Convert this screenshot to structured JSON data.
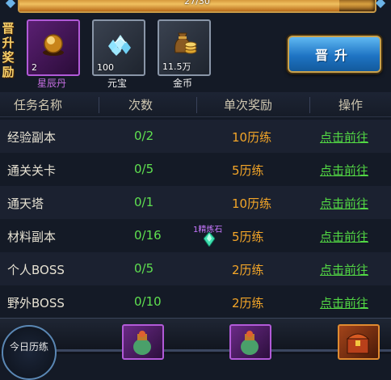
{
  "progress": {
    "text": "27/30",
    "fraction": 0.9
  },
  "section_title": "晋升奖励",
  "rewards": [
    {
      "name": "星辰丹",
      "count": "2",
      "icon": "golden-orb-icon",
      "rarity": "purple"
    },
    {
      "name": "元宝",
      "count": "100",
      "icon": "diamond-pile-icon",
      "rarity": "gray"
    },
    {
      "name": "金币",
      "count": "11.5万",
      "icon": "coin-bag-icon",
      "rarity": "gray"
    }
  ],
  "promote_button": "晋升",
  "table": {
    "headers": [
      "任务名称",
      "次数",
      "单次奖励",
      "操作"
    ],
    "rows": [
      {
        "name": "经验副本",
        "count": "0/2",
        "reward": "10历练",
        "action": "点击前往"
      },
      {
        "name": "通关关卡",
        "count": "0/5",
        "reward": "5历练",
        "action": "点击前往"
      },
      {
        "name": "通天塔",
        "count": "0/1",
        "reward": "10历练",
        "action": "点击前往"
      },
      {
        "name": "材料副本",
        "count": "0/16",
        "reward": "5历练",
        "action": "点击前往"
      },
      {
        "name": "个人BOSS",
        "count": "0/5",
        "reward": "2历练",
        "action": "点击前往"
      },
      {
        "name": "野外BOSS",
        "count": "0/10",
        "reward": "2历练",
        "action": "点击前往"
      }
    ]
  },
  "floating_item": {
    "label": "1精炼石",
    "icon": "refine-stone-icon"
  },
  "daily": {
    "label": "今日历练"
  },
  "colors": {
    "count": "#5fe050",
    "reward": "#f4a628",
    "link": "#52d844",
    "purple": "#b25ad8"
  }
}
